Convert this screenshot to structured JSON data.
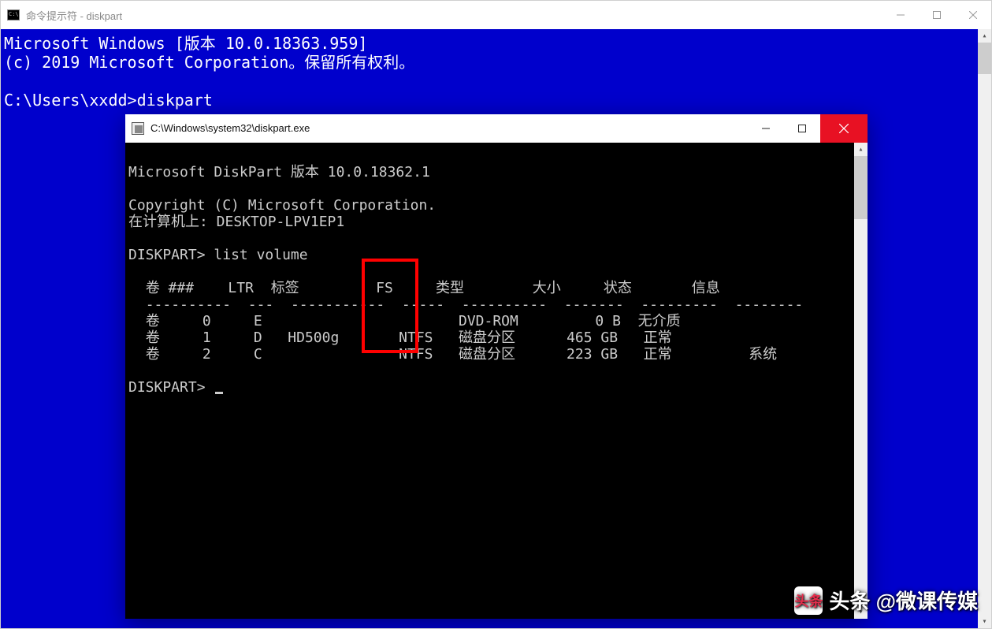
{
  "outer": {
    "title": "命令提示符 - diskpart",
    "line1": "Microsoft Windows [版本 10.0.18363.959]",
    "line2": "(c) 2019 Microsoft Corporation。保留所有权利。",
    "prompt_path": "C:\\Users\\xxdd>",
    "prompt_cmd": "diskpart"
  },
  "inner": {
    "title": "C:\\Windows\\system32\\diskpart.exe",
    "version_line": "Microsoft DiskPart 版本 10.0.18362.1",
    "copyright_line": "Copyright (C) Microsoft Corporation.",
    "computer_line": "在计算机上: DESKTOP-LPV1EP1",
    "prompt1": "DISKPART>",
    "cmd1": "list volume",
    "prompt2": "DISKPART>",
    "table": {
      "headers": {
        "volume": "卷",
        "num": "###",
        "ltr": "LTR",
        "label": "标签",
        "fs": "FS",
        "type": "类型",
        "size": "大小",
        "status": "状态",
        "info": "信息"
      },
      "dashes": {
        "volume": "----------",
        "ltr": "---",
        "label": "-----------",
        "fs": "-----",
        "type": "----------",
        "size": "-------",
        "status": "---------",
        "info": "--------"
      },
      "rows": [
        {
          "volume": "卷",
          "num": "0",
          "ltr": "E",
          "label": "",
          "fs": "",
          "type": "DVD-ROM",
          "size": "0 B",
          "status": "无介质",
          "info": ""
        },
        {
          "volume": "卷",
          "num": "1",
          "ltr": "D",
          "label": "HD500g",
          "fs": "NTFS",
          "type": "磁盘分区",
          "size": "465 GB",
          "status": "正常",
          "info": ""
        },
        {
          "volume": "卷",
          "num": "2",
          "ltr": "C",
          "label": "",
          "fs": "NTFS",
          "type": "磁盘分区",
          "size": "223 GB",
          "status": "正常",
          "info": "系统"
        }
      ]
    }
  },
  "watermark": "头条 @微课传媒"
}
